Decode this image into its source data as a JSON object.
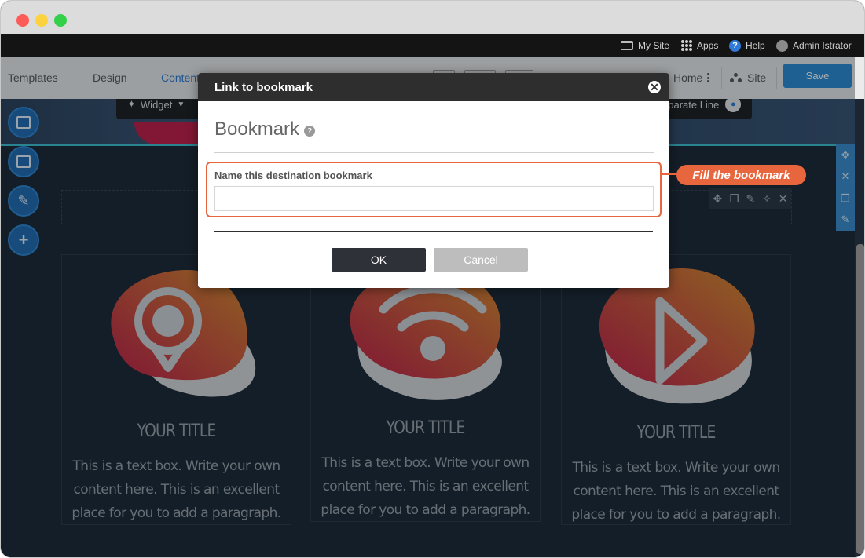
{
  "admin_bar": {
    "my_site": "My Site",
    "apps": "Apps",
    "help": "Help",
    "user": "Admin Istrator"
  },
  "editor_bar": {
    "tabs": [
      "Templates",
      "Design",
      "Content"
    ],
    "active_tab": "Content",
    "home_label": "Home",
    "site_label": "Site",
    "save_label": "Save"
  },
  "canvas": {
    "widget_label": "Widget",
    "separate_line_label": "eparate Line",
    "columns": [
      {
        "icon": "location-pin-icon",
        "title": "YOUR TITLE",
        "text": "This is a text box. Write your own content here. This is an excellent place for you to add a paragraph."
      },
      {
        "icon": "wifi-icon",
        "title": "YOUR TITLE",
        "text": "This is a text box. Write your own content here. This is an excellent place for you to add a paragraph."
      },
      {
        "icon": "play-icon",
        "title": "YOUR TITLE",
        "text": "This is a text box. Write your own content here. This is an excellent place for you to add a paragraph."
      }
    ]
  },
  "dialog": {
    "title": "Link to bookmark",
    "heading": "Bookmark",
    "field_label": "Name this destination bookmark",
    "field_value": "",
    "field_placeholder": "",
    "ok_label": "OK",
    "cancel_label": "Cancel"
  },
  "callout": {
    "text": "Fill the bookmark"
  },
  "colors": {
    "accent_blue": "#2b8ad6",
    "callout_orange": "#e8663d",
    "canvas_bg": "#1b2632",
    "blob_red": "#c21b45",
    "blob_orange": "#d9862a"
  }
}
